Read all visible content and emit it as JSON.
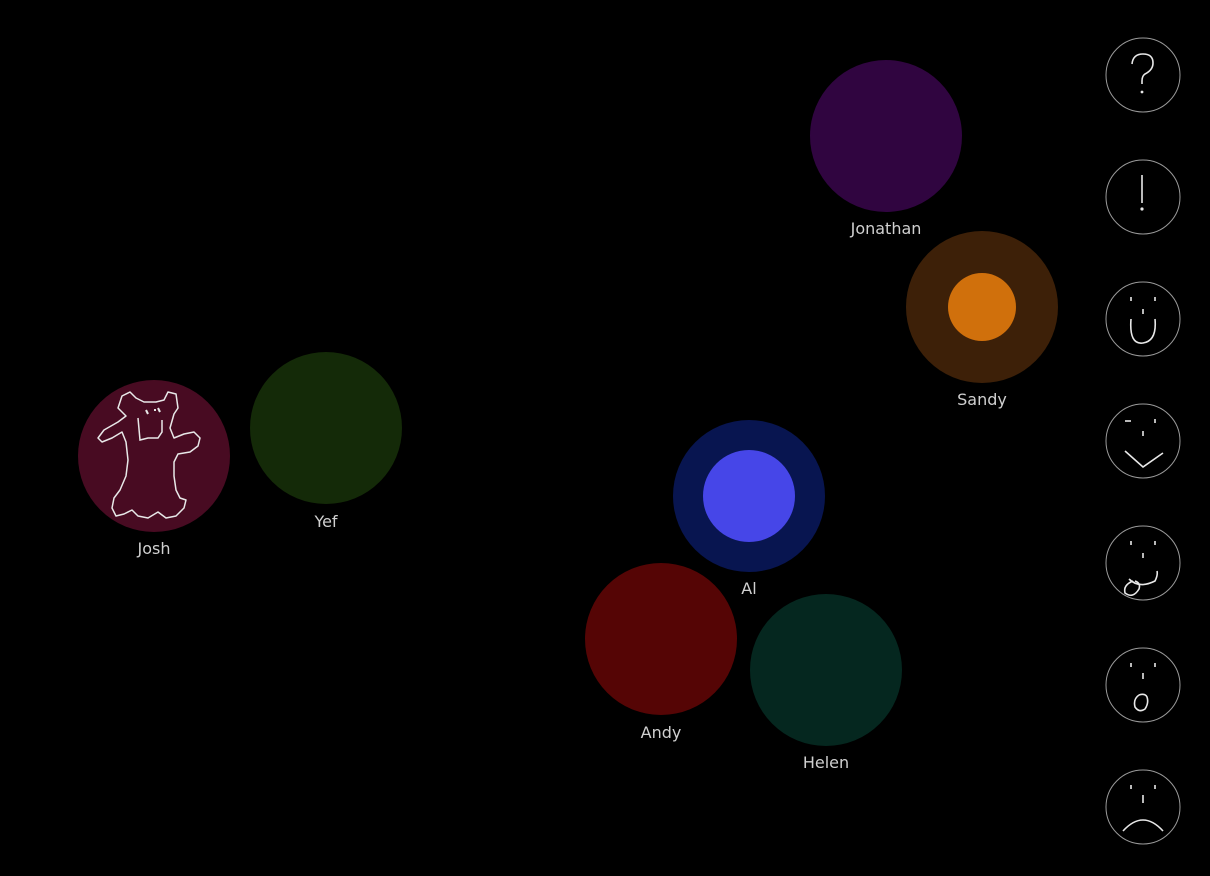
{
  "participants": [
    {
      "id": "jonathan",
      "name": "Jonathan",
      "color": "#300540"
    },
    {
      "id": "sandy",
      "name": "Sandy",
      "color": "#3d2008",
      "speaking_color": "#d0700c"
    },
    {
      "id": "josh",
      "name": "Josh",
      "color": "#480b22",
      "doodle": "bear-doodle"
    },
    {
      "id": "yef",
      "name": "Yef",
      "color": "#142a08"
    },
    {
      "id": "al",
      "name": "Al",
      "color": "#081550",
      "speaking_color": "#4646e8"
    },
    {
      "id": "andy",
      "name": "Andy",
      "color": "#550505"
    },
    {
      "id": "helen",
      "name": "Helen",
      "color": "#05271f"
    }
  ],
  "emote_buttons": [
    {
      "id": "question",
      "icon": "question-mark-icon"
    },
    {
      "id": "exclaim",
      "icon": "exclamation-icon"
    },
    {
      "id": "happy",
      "icon": "smiley-icon"
    },
    {
      "id": "wink",
      "icon": "wink-icon"
    },
    {
      "id": "tongue",
      "icon": "tongue-out-icon"
    },
    {
      "id": "surprised",
      "icon": "surprised-icon"
    },
    {
      "id": "sad",
      "icon": "frown-icon"
    }
  ],
  "colors": {
    "background": "#000000",
    "label": "#d0d0d0",
    "stroke": "#e8e8e8",
    "button_ring": "#9a9a9a"
  }
}
